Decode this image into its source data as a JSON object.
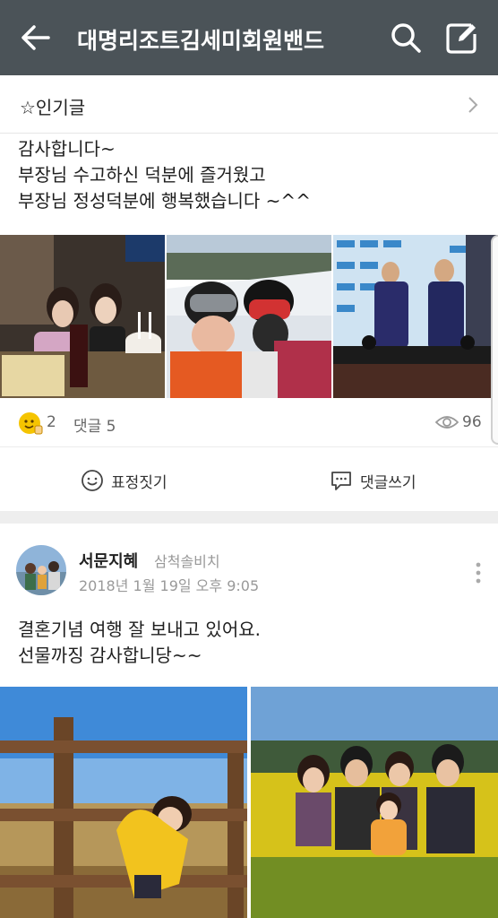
{
  "header": {
    "title": "대명리조트김세미회원밴드",
    "back_icon": "arrow-left-icon",
    "search_icon": "search-icon",
    "write_icon": "compose-icon"
  },
  "popular": {
    "label": "☆인기글"
  },
  "post1": {
    "lines": [
      "감사합니다~",
      "부장님 수고하신 덕분에 즐거웠고",
      "부장님 정성덕분에 행복했습니다 ~^^"
    ],
    "reaction_count": "2",
    "comments_label": "댓글 5",
    "views": "96",
    "emotion_label": "표정짓기",
    "comment_label": "댓글쓰기"
  },
  "post2": {
    "author": "서문지혜",
    "location": "삼척솔비치",
    "date": "2018년 1월 19일 오후 9:05",
    "lines": [
      "결혼기념 여행 잘 보내고 있어요.",
      "선물까징 감사합니당~~"
    ]
  },
  "colors": {
    "header_bg": "#4b5358",
    "divider": "#eeeeee",
    "reaction_emoji": "#f5c400"
  }
}
